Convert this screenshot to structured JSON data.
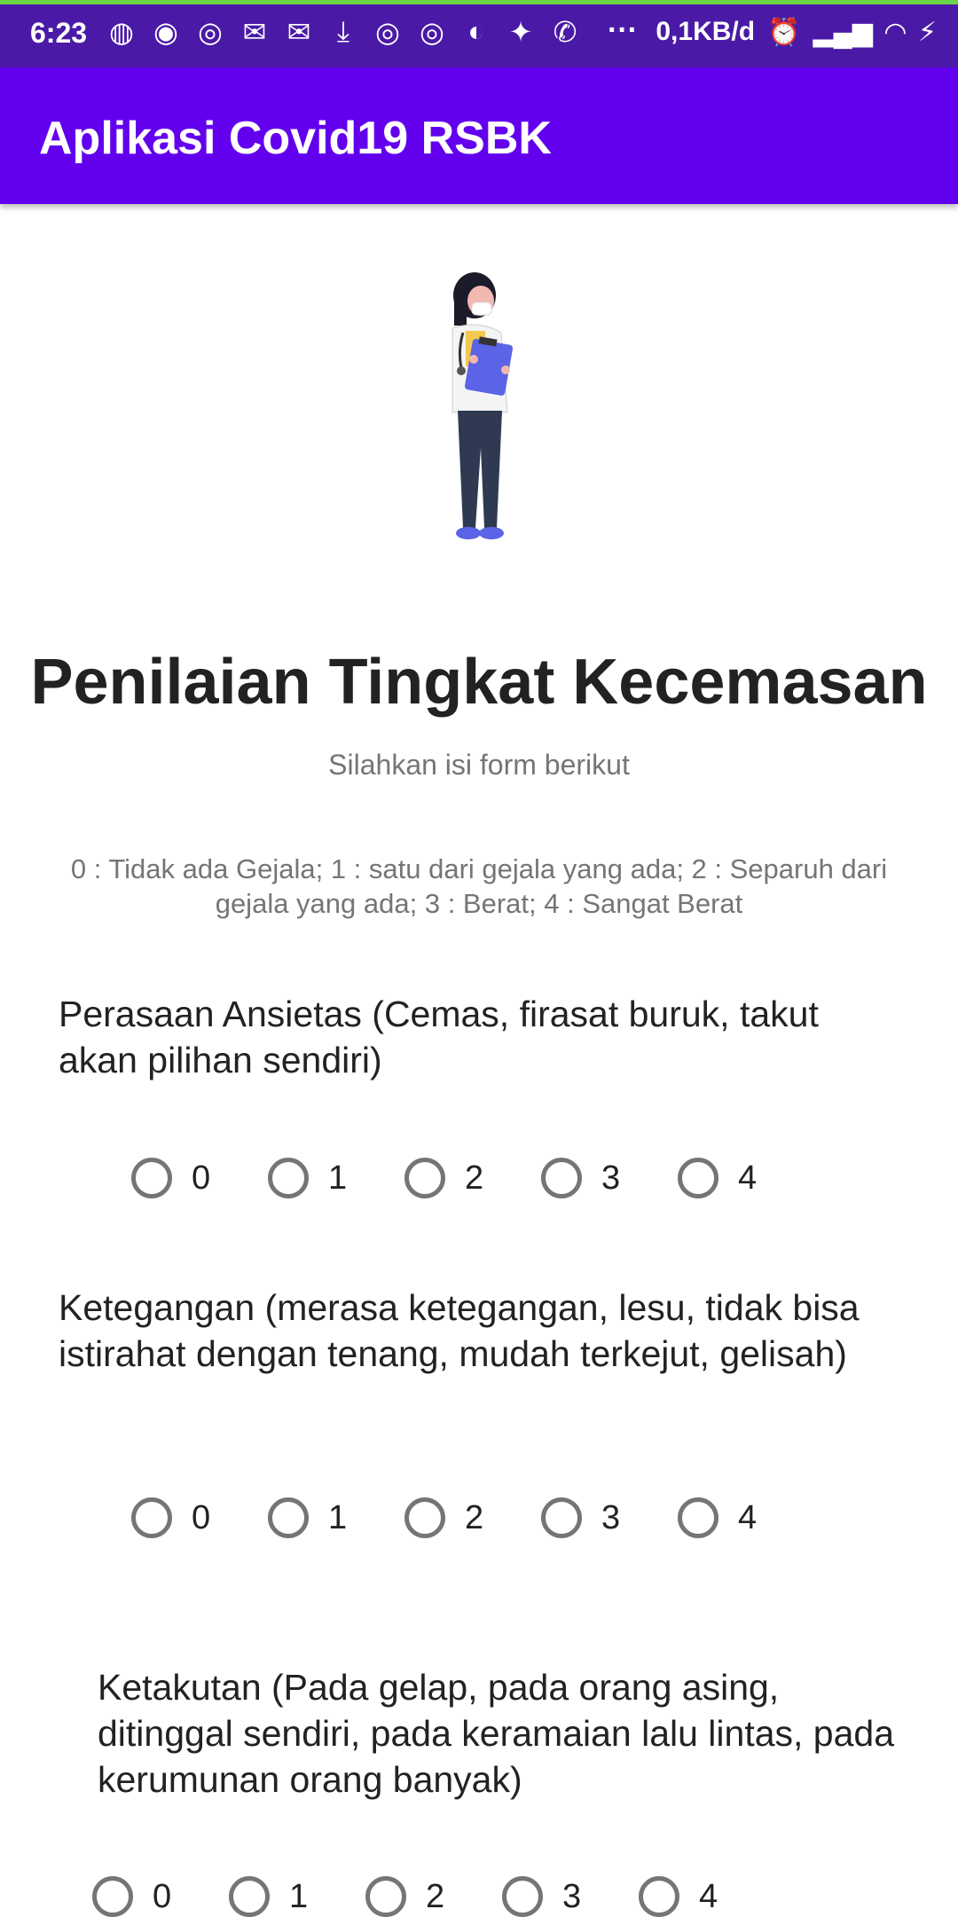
{
  "status_bar": {
    "time": "6:23",
    "network_speed": "0,1KB/d",
    "icons": [
      "loading-icon",
      "discord-icon",
      "instagram-icon",
      "gmail-icon",
      "gmail-icon",
      "download-icon",
      "instagram-icon",
      "instagram-icon",
      "refresh-icon",
      "twitter-icon",
      "whatsapp-icon",
      "more-icon",
      "alarm-icon",
      "signal-icon",
      "wifi-icon",
      "charging-icon"
    ]
  },
  "app_bar": {
    "title": "Aplikasi Covid19 RSBK"
  },
  "colors": {
    "primary": "#6200ee",
    "status_bar": "#4a1aa6",
    "text": "#222222",
    "secondary_text": "#757575"
  },
  "page": {
    "title": "Penilaian Tingkat Kecemasan",
    "subtitle": "Silahkan isi form berikut",
    "legend": "0 : Tidak ada Gejala; 1 : satu dari gejala yang ada; 2 : Separuh dari gejala yang ada; 3 : Berat; 4 : Sangat Berat"
  },
  "questions": [
    {
      "text": "Perasaan Ansietas (Cemas, firasat buruk, takut akan pilihan sendiri)",
      "options": [
        "0",
        "1",
        "2",
        "3",
        "4"
      ]
    },
    {
      "text": "Ketegangan (merasa ketegangan, lesu, tidak bisa istirahat dengan tenang, mudah terkejut, gelisah)",
      "options": [
        "0",
        "1",
        "2",
        "3",
        "4"
      ]
    },
    {
      "text": "Ketakutan (Pada gelap, pada orang asing, ditinggal sendiri, pada keramaian lalu lintas, pada kerumunan orang banyak)",
      "options": [
        "0",
        "1",
        "2",
        "3",
        "4"
      ]
    }
  ]
}
